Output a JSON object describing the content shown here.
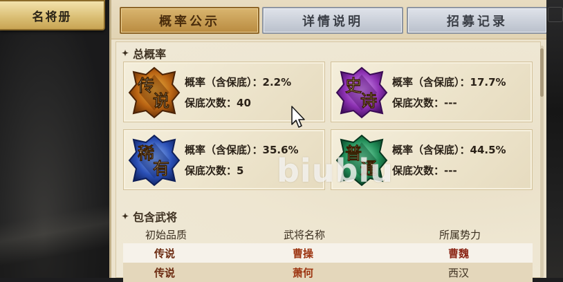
{
  "side_tab": {
    "label": "名将册"
  },
  "tabs": [
    {
      "label": "概率公示",
      "active": true
    },
    {
      "label": "详情说明",
      "active": false
    },
    {
      "label": "招募记录",
      "active": false
    }
  ],
  "total_section": {
    "title": "总概率"
  },
  "rarities": [
    {
      "emblem": "传说",
      "icon": "legendary-emblem-icon",
      "color": "#c9781c",
      "rate_label": "概率（含保底）：",
      "rate": "2.2%",
      "pity_label": "保底次数：",
      "pity": "40"
    },
    {
      "emblem": "史诗",
      "icon": "epic-emblem-icon",
      "color": "#8a2fb0",
      "rate_label": "概率（含保底）：",
      "rate": "17.7%",
      "pity_label": "保底次数：",
      "pity": "---"
    },
    {
      "emblem": "稀有",
      "icon": "rare-emblem-icon",
      "color": "#2a4fb5",
      "rate_label": "概率（含保底）：",
      "rate": "35.6%",
      "pity_label": "保底次数：",
      "pity": "5"
    },
    {
      "emblem": "普通",
      "icon": "common-emblem-icon",
      "color": "#1f8a55",
      "rate_label": "概率（含保底）：",
      "rate": "44.5%",
      "pity_label": "保底次数：",
      "pity": "---"
    }
  ],
  "generals_section": {
    "title": "包含武将",
    "headers": [
      "初始品质",
      "武将名称",
      "所属势力"
    ],
    "rows": [
      [
        "传说",
        "曹操",
        "曹魏"
      ],
      [
        "传说",
        "萧何",
        "西汉"
      ]
    ]
  },
  "watermark": "biubiu"
}
